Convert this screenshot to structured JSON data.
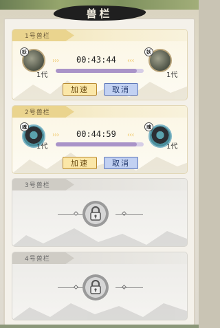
{
  "title": "兽栏",
  "slots": [
    {
      "label": "1号兽栏",
      "state": "active",
      "left_badge": "妖",
      "right_badge": "妖",
      "left_gen": "1代",
      "right_gen": "1代",
      "timer": "00:43:44",
      "progress": 0.92,
      "speed_label": "加速",
      "cancel_label": "取消"
    },
    {
      "label": "2号兽栏",
      "state": "active",
      "left_badge": "魂",
      "right_badge": "魂",
      "left_gen": "1代",
      "right_gen": "1代",
      "timer": "00:44:59",
      "progress": 0.92,
      "speed_label": "加速",
      "cancel_label": "取消"
    },
    {
      "label": "3号兽栏",
      "state": "locked"
    },
    {
      "label": "4号兽栏",
      "state": "locked"
    }
  ],
  "colors": {
    "progress_fill": "#a993c8",
    "speed_button": "#fbe7a8",
    "cancel_button": "#c2d1f2"
  }
}
